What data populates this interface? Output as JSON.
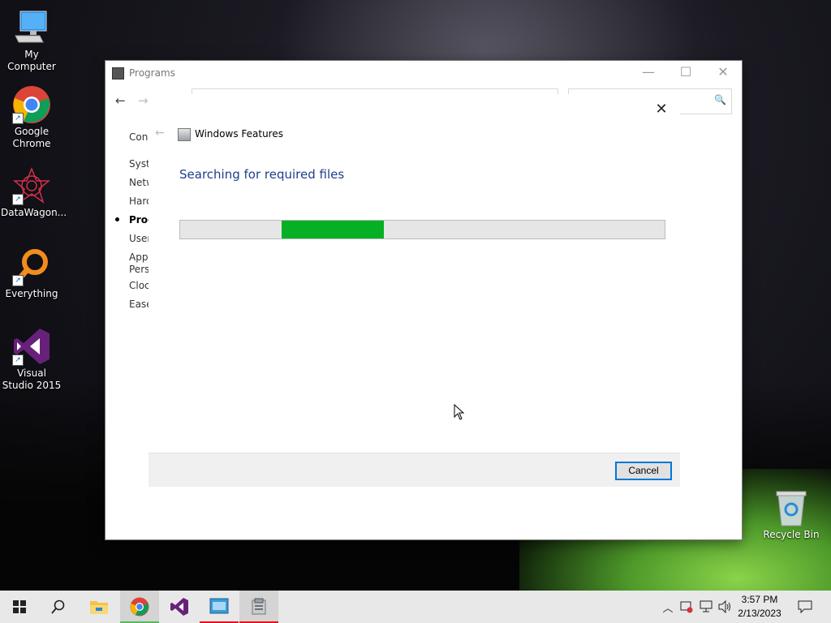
{
  "desktop": {
    "icons": [
      {
        "label": "My Computer"
      },
      {
        "label": "Google Chrome"
      },
      {
        "label": "DataWagon..."
      },
      {
        "label": "Everything"
      },
      {
        "label": "Visual Studio 2015"
      },
      {
        "label": "Recycle Bin"
      }
    ]
  },
  "programs_window": {
    "title": "Programs",
    "controls": {
      "minimize": "—",
      "maximize": "☐",
      "close": "✕"
    },
    "sidebar": {
      "header": "Con",
      "items": [
        {
          "label": "Syste"
        },
        {
          "label": "Netw"
        },
        {
          "label": "Harc"
        },
        {
          "label": "Prog"
        },
        {
          "label": "User"
        },
        {
          "label": "App"
        },
        {
          "label": "Pers"
        },
        {
          "label": "Cloc"
        },
        {
          "label": "Ease"
        }
      ]
    },
    "search_icon": "🔍"
  },
  "features_dialog": {
    "title": "Windows Features",
    "heading": "Searching for required files",
    "progress": {
      "fill_start_fraction": 0.21,
      "fill_end_fraction": 0.42
    },
    "cancel_label": "Cancel",
    "close_glyph": "✕",
    "back_glyph": "←"
  },
  "taskbar": {
    "items": [
      {
        "name": "start",
        "icon": "windows-logo"
      },
      {
        "name": "search",
        "icon": "search-icon"
      },
      {
        "name": "file-explorer",
        "icon": "folder-icon"
      },
      {
        "name": "chrome",
        "icon": "chrome-icon"
      },
      {
        "name": "visual-studio",
        "icon": "visual-studio-icon"
      },
      {
        "name": "control-panel",
        "icon": "control-panel-icon"
      },
      {
        "name": "windows-features",
        "icon": "features-icon"
      }
    ],
    "clock": {
      "time": "3:57 PM",
      "date": "2/13/2023"
    },
    "colors": {
      "chrome_underline": "#5cb85c",
      "active_underline": "#e81123",
      "progress_fill": "#06b025"
    }
  }
}
